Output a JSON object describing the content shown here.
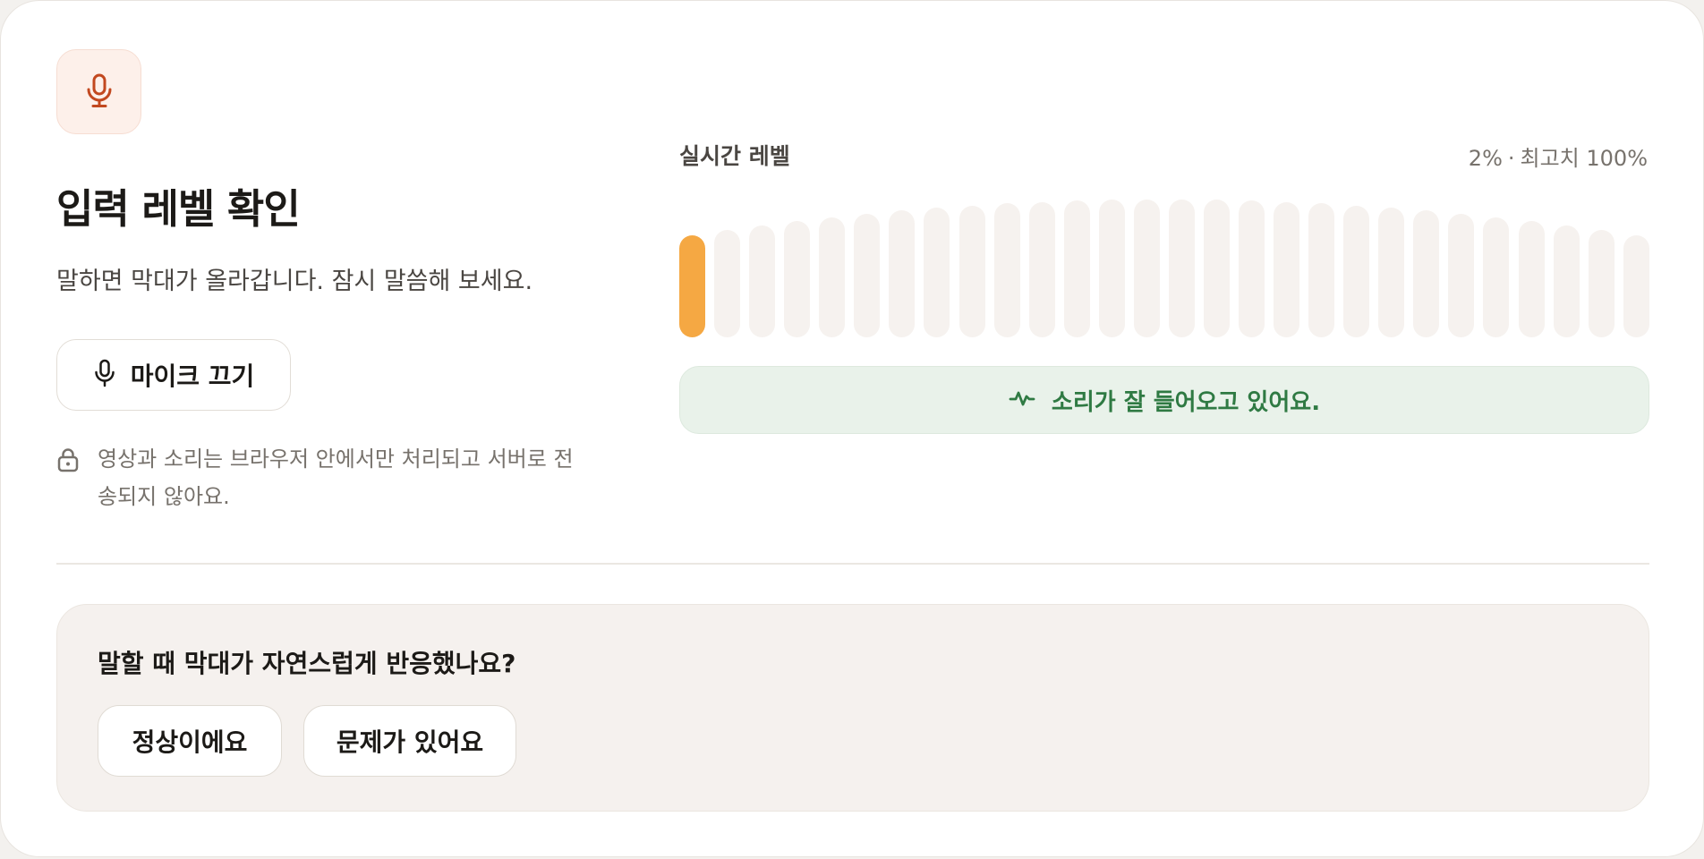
{
  "header": {
    "icon": "microphone-icon",
    "title": "입력 레벨 확인",
    "subtitle": "말하면 막대가 올라갑니다. 잠시 말씀해 보세요."
  },
  "mic_button": {
    "icon": "microphone-icon",
    "label": "마이크 끄기"
  },
  "privacy": {
    "icon": "lock-icon",
    "text": "영상과 소리는 브라우저 안에서만 처리되고 서버로 전송되지 않아요."
  },
  "meter": {
    "label": "실시간 레벨",
    "current": "2%",
    "separator": "·",
    "peak": "최고치 100%",
    "current_level": 0.02,
    "active_color": "#f5a843",
    "inactive_color": "#f6f2ef",
    "bar_count": 28,
    "active_bars": 1
  },
  "status": {
    "icon": "activity-pulse-icon",
    "text": "소리가 잘 들어오고 있어요.",
    "color": "#2f7a43"
  },
  "feedback": {
    "question": "말할 때 막대가 자연스럽게 반응했나요?",
    "ok_label": "정상이에요",
    "issue_label": "문제가 있어요"
  }
}
